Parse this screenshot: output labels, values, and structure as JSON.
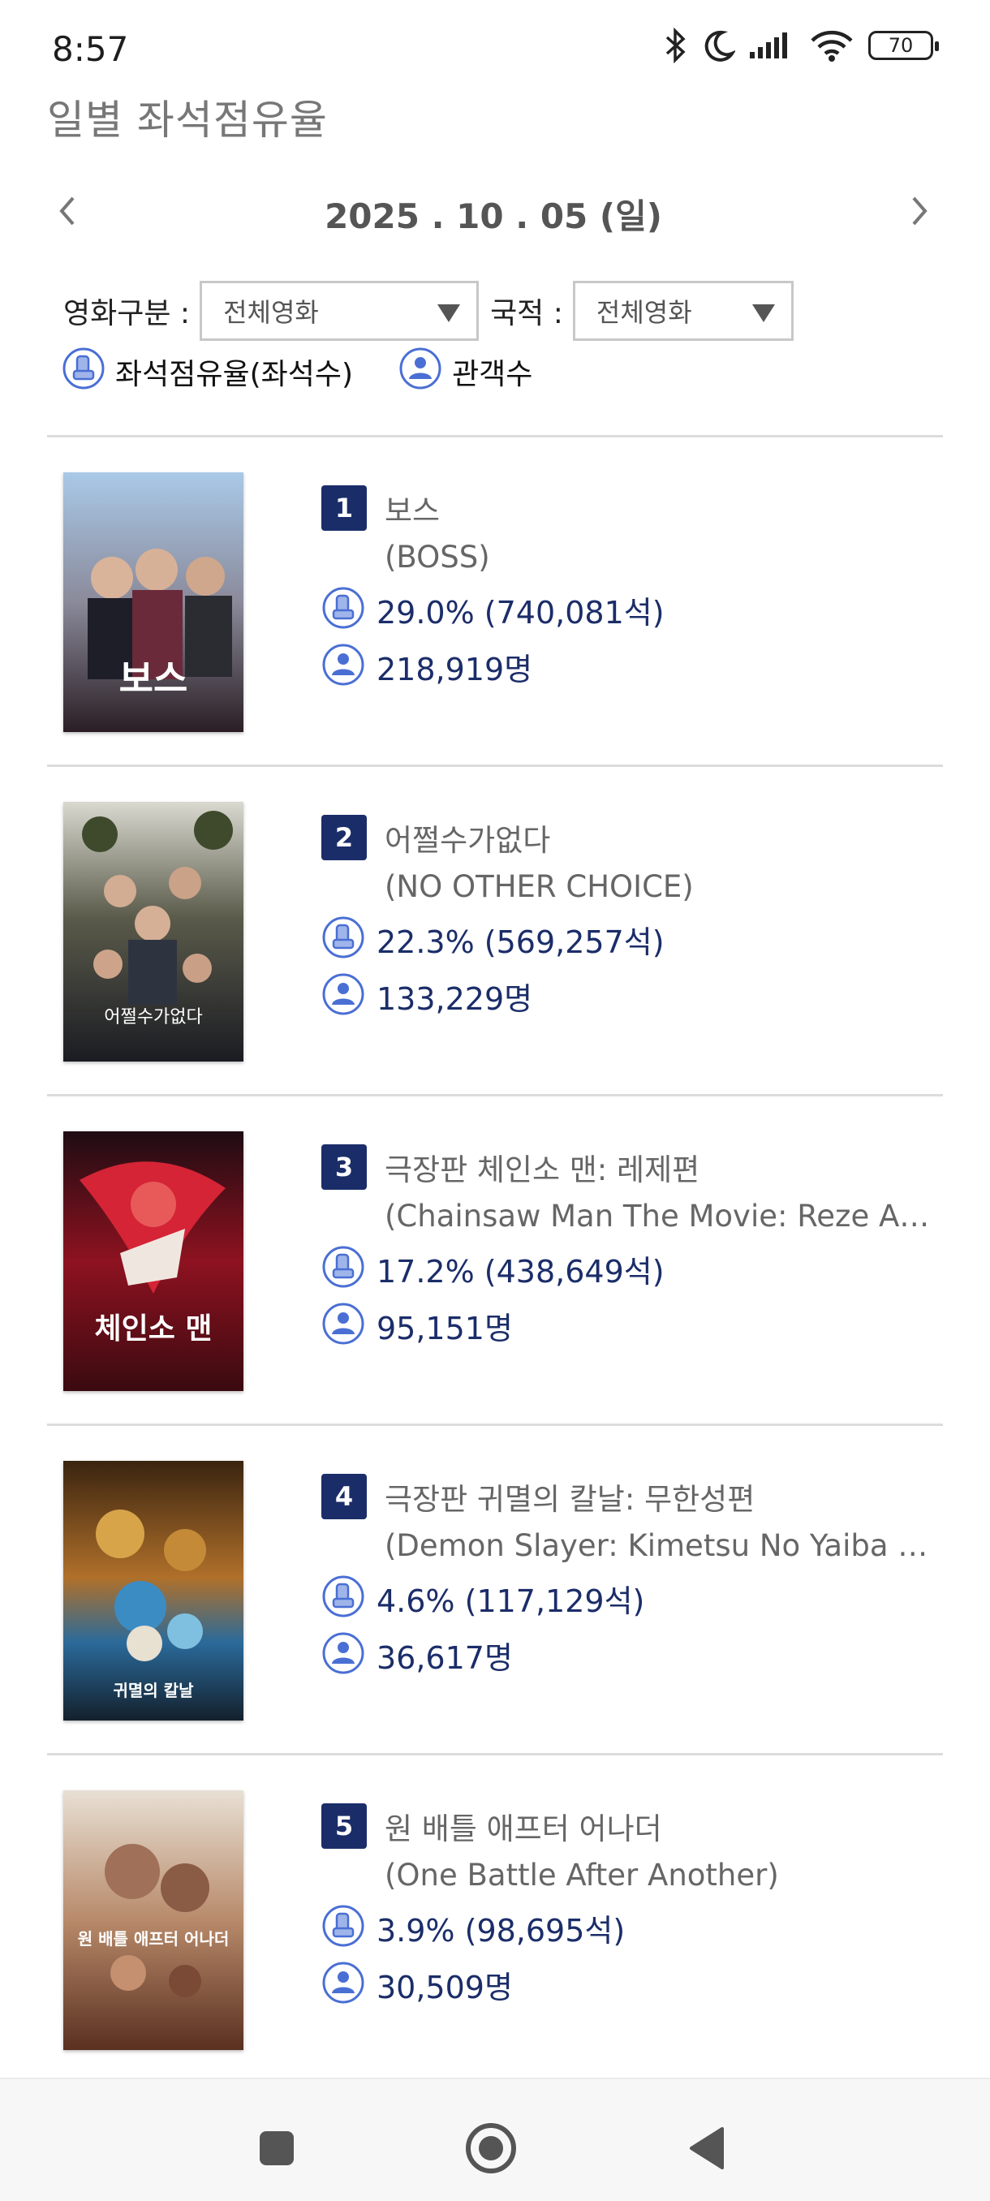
{
  "status_bar": {
    "time": "8:57",
    "battery": "70"
  },
  "page": {
    "title": "일별 좌석점유율"
  },
  "date_nav": {
    "date": "2025 . 10 . 05 (일)"
  },
  "filters": {
    "genre_label": "영화구분 :",
    "genre_value": "전체영화",
    "nation_label": "국적 :",
    "nation_value": "전체영화"
  },
  "legend": {
    "seat_share": "좌석점유율(좌석수)",
    "audience": "관객수"
  },
  "movies": [
    {
      "rank": "1",
      "title_ko": "보스",
      "title_en": "(BOSS)",
      "seat_share": "29.0% (740,081석)",
      "audience": "218,919명",
      "poster_overlay": "보스"
    },
    {
      "rank": "2",
      "title_ko": "어쩔수가없다",
      "title_en": "(NO OTHER CHOICE)",
      "seat_share": "22.3% (569,257석)",
      "audience": "133,229명",
      "poster_overlay": "어쩔수가없다"
    },
    {
      "rank": "3",
      "title_ko": "극장판 체인소 맨: 레제편",
      "title_en": "(Chainsaw Man The Movie: Reze Arc)",
      "seat_share": "17.2% (438,649석)",
      "audience": "95,151명",
      "poster_overlay": "체인소 맨"
    },
    {
      "rank": "4",
      "title_ko": "극장판 귀멸의 칼날: 무한성편",
      "title_en": "(Demon Slayer: Kimetsu No Yaiba …",
      "seat_share": "4.6% (117,129석)",
      "audience": "36,617명",
      "poster_overlay": "귀멸의 칼날"
    },
    {
      "rank": "5",
      "title_ko": "원 배틀 애프터 어나더",
      "title_en": "(One Battle After Another)",
      "seat_share": "3.9% (98,695석)",
      "audience": "30,509명",
      "poster_overlay": "원 배틀 애프터 어나더"
    }
  ],
  "colors": {
    "accent_navy": "#1b2d69",
    "icon_blue": "#4a6fd4",
    "text_gray": "#666666"
  }
}
